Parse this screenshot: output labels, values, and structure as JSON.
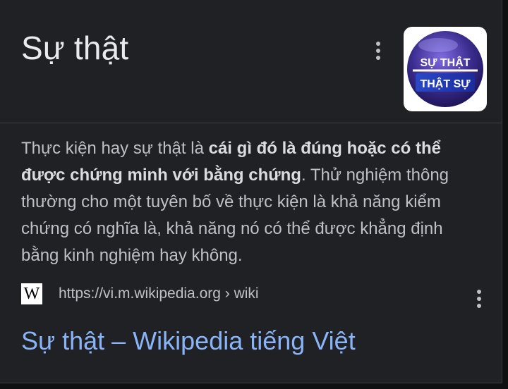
{
  "panel": {
    "title": "Sự thật",
    "thumbnail": {
      "line1": "SỰ THẬT",
      "line2": "THẬT SỰ",
      "colors": {
        "sphere": "#3b2d8f",
        "accent": "#1c2c9c",
        "text": "#ffffff"
      }
    }
  },
  "description": {
    "part1": "Thực kiện hay sự thật là ",
    "bold": "cái gì đó là đúng hoặc có thể được chứng minh với bằng chứng",
    "part2": ". Thử nghiệm thông thường cho một tuyên bố về thực kiện là khả năng kiểm chứng có nghĩa là, khả năng nó có thể được khẳng định bằng kinh nghiệm hay không."
  },
  "source": {
    "logo_letter": "W",
    "url": "https://vi.m.wikipedia.org › wiki"
  },
  "result": {
    "title": "Sự thật – Wikipedia tiếng Việt"
  },
  "colors": {
    "background": "#202124",
    "title_text": "#e8eaed",
    "body_text": "#bdc1c6",
    "link": "#8ab4f8"
  },
  "icons": [
    "more-vert-icon",
    "wikipedia-logo-icon"
  ]
}
